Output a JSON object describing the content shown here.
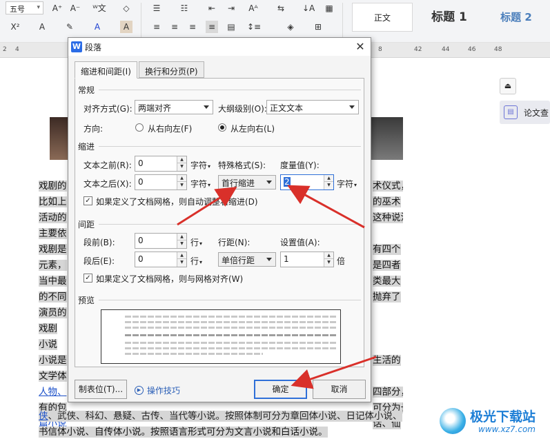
{
  "ribbon": {
    "font_size": "五号",
    "style_normal": "正文",
    "style_h1": "标题 1",
    "style_h2": "标题 2"
  },
  "ruler": [
    "2",
    "4",
    "42",
    "44",
    "46",
    "48"
  ],
  "ruler_right_first": "8",
  "side_panel": {
    "label": "论文查"
  },
  "watermark": {
    "title": "极光下载站",
    "url": "www.xz7.com"
  },
  "document": {
    "left_lines": [
      "戏剧的",
      "比如上",
      "活动的",
      "主要依",
      "戏剧是",
      "元素，",
      "当中最",
      "的不同",
      "演员的",
      "戏剧",
      "小说",
      "小说是",
      "文学体"
    ],
    "left_link_line1": "人物、",
    "left_line_after_link": "有的包",
    "left_link_line2": "篇小说",
    "right_lines": [
      "术仪式，",
      "的巫术",
      "这种说法",
      "",
      "有四个",
      "是四者",
      "类最大",
      "抛弃了",
      "",
      "",
      "",
      "生活的",
      "",
      "四部分，",
      "可分为长",
      "话、仙"
    ],
    "bottom_line1_link": "侠",
    "bottom_line1": "、武侠、科幻、悬疑、古传、当代等小说。按照体制可分为章回体小说、日记体小说、",
    "bottom_line2": "书信体小说、自传体小说。按照语言形式可分为文言小说和白话小说。"
  },
  "dialog": {
    "title": "段落",
    "logo": "W",
    "tabs": [
      "缩进和间距(I)",
      "换行和分页(P)"
    ],
    "general": {
      "section": "常规",
      "align_label": "对齐方式(G):",
      "align_value": "两端对齐",
      "outline_label": "大纲级别(O):",
      "outline_value": "正文文本",
      "direction_label": "方向:",
      "rtl": "从右向左(F)",
      "ltr": "从左向右(L)"
    },
    "indent": {
      "section": "缩进",
      "before_label": "文本之前(R):",
      "before_value": "0",
      "after_label": "文本之后(X):",
      "after_value": "0",
      "unit": "字符",
      "special_label": "特殊格式(S):",
      "special_value": "首行缩进",
      "measure_label": "度量值(Y):",
      "measure_value": "2",
      "grid_check": "如果定义了文档网格，则自动调整右缩进(D)"
    },
    "spacing": {
      "section": "间距",
      "before_label": "段前(B):",
      "before_value": "0",
      "after_label": "段后(E):",
      "after_value": "0",
      "unit": "行",
      "line_label": "行距(N):",
      "line_value": "单倍行距",
      "set_label": "设置值(A):",
      "set_value": "1",
      "set_unit": "倍",
      "grid_check": "如果定义了文档网格，则与网格对齐(W)"
    },
    "preview": {
      "section": "预览"
    },
    "buttons": {
      "tabs": "制表位(T)...",
      "tips": "操作技巧",
      "ok": "确定",
      "cancel": "取消"
    }
  },
  "colors": {
    "accent": "#2e6fd8",
    "arrow": "#d9302a",
    "link": "#1a4fc9"
  }
}
